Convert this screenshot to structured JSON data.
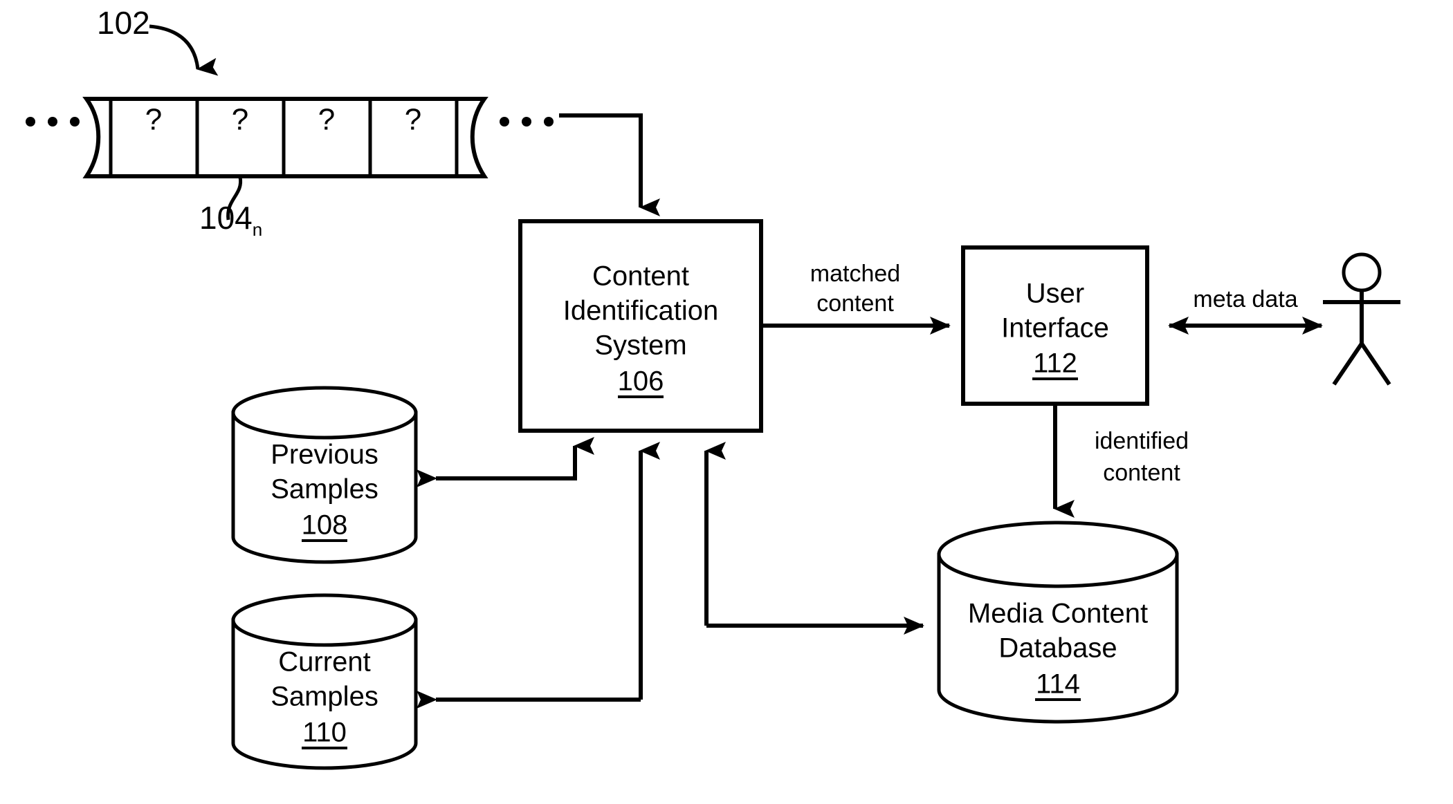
{
  "figure": {
    "type": "patent-block-diagram",
    "background": "#ffffff",
    "line_color": "#000000"
  },
  "stream": {
    "ref_label": "102",
    "cell_ref_label": "104",
    "cell_ref_subscript": "n",
    "cells": [
      "?",
      "?",
      "?",
      "?"
    ],
    "left_ellipsis": "• • •",
    "right_ellipsis": "• • •"
  },
  "nodes": {
    "cis": {
      "shape": "rectangle",
      "line1": "Content",
      "line2": "Identification",
      "line3": "System",
      "ref": "106"
    },
    "ui": {
      "shape": "rectangle",
      "line1": "User",
      "line2": "Interface",
      "ref": "112"
    },
    "previous_samples": {
      "shape": "cylinder",
      "line1": "Previous",
      "line2": "Samples",
      "ref": "108"
    },
    "current_samples": {
      "shape": "cylinder",
      "line1": "Current",
      "line2": "Samples",
      "ref": "110"
    },
    "media_db": {
      "shape": "cylinder",
      "line1": "Media Content",
      "line2": "Database",
      "ref": "114"
    },
    "actor": {
      "shape": "stick-figure",
      "label": ""
    }
  },
  "edges": {
    "matched_content": {
      "line1": "matched",
      "line2": "content"
    },
    "meta_data": {
      "line1": "meta data"
    },
    "identified_content": {
      "line1": "identified",
      "line2": "content"
    }
  }
}
